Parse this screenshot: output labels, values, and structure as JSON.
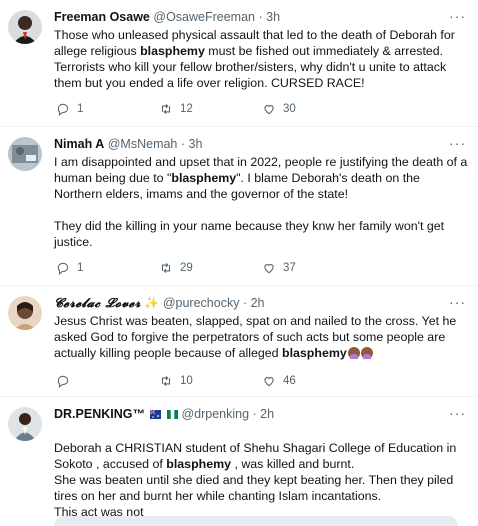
{
  "tweets": [
    {
      "name": "Freeman Osawe",
      "handle": "@OsaweFreeman",
      "dot": "·",
      "time": "3h",
      "more": "···",
      "text_parts": [
        [
          "Those who unleased physical assault that led to the death of Deborah for allege religious ",
          "blasphemy",
          " must be fished out immediately & arrested. Terrorists who kill your fellow brother/sisters, why didn't u unite to attack them but you ended a life over religion. CURSED RACE!"
        ]
      ],
      "replies": "1",
      "retweets": "12",
      "likes": "30"
    },
    {
      "name": "Nimah A",
      "handle": "@MsNemah",
      "dot": "·",
      "time": "3h",
      "more": "···",
      "text_parts": [
        [
          "I am disappointed and upset that in 2022, people re justifying the death of a human being due to \"",
          "blasphemy",
          "\".  I blame Deborah's death on the Northern elders, imams and the governor of the state!"
        ],
        [
          "They did the killing in your name because they knw her family won't get justice.",
          "",
          ""
        ]
      ],
      "replies": "1",
      "retweets": "29",
      "likes": "37"
    },
    {
      "name": "𝓒𝓮𝓻𝓮𝓵𝓪𝓬 𝓛𝓸𝓿𝓮𝓻",
      "handle": "@purechocky",
      "dot": "·",
      "time": "2h",
      "more": "···",
      "text_parts": [
        [
          "Jesus Christ was beaten, slapped, spat on and nailed to the cross. Yet he asked God to forgive the perpetrators of such acts but some people are actually killing people because of alleged ",
          "blasphemy",
          ""
        ]
      ],
      "replies": "",
      "retweets": "10",
      "likes": "46"
    },
    {
      "name": "DR.PENKING™",
      "handle": "@drpenking",
      "dot": "·",
      "time": "2h",
      "more": "···",
      "text_parts": [
        [
          "Deborah a CHRISTIAN student of Shehu Shagari College of Education in Sokoto , accused of ",
          "blasphemy",
          " , was killed and burnt.\nShe was beaten until she died and they kept beating her. Then they piled tires on her and burnt her while chanting Islam incantations.\nThis act was not"
        ]
      ]
    }
  ],
  "colors": {
    "icon": "#536471",
    "text": "#0f1419",
    "border": "#eff3f4"
  },
  "icons": {
    "reply": "reply-icon",
    "retweet": "retweet-icon",
    "like": "heart-icon",
    "more": "more-icon"
  }
}
